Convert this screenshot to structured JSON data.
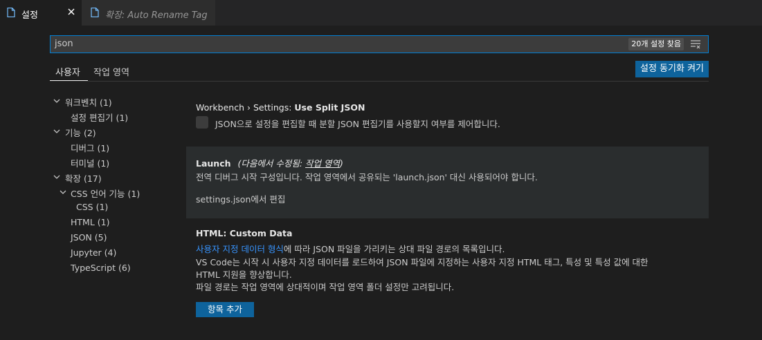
{
  "tabs": [
    {
      "label": "설정",
      "icon": "file-icon"
    },
    {
      "label": "확장: Auto Rename Tag",
      "icon": "file-icon"
    }
  ],
  "search": {
    "query": "json",
    "result_count": "20개 설정 찾음"
  },
  "scopes": {
    "user": "사용자",
    "workspace": "작업 영역"
  },
  "sync_button": "설정 동기화 켜기",
  "toc": [
    {
      "label": "워크벤치 (1)",
      "level": 0,
      "expanded": true
    },
    {
      "label": "설정 편집기 (1)",
      "level": 1
    },
    {
      "label": "기능 (2)",
      "level": 0,
      "expanded": true
    },
    {
      "label": "디버그 (1)",
      "level": 1
    },
    {
      "label": "터미널 (1)",
      "level": 1
    },
    {
      "label": "확장 (17)",
      "level": 0,
      "expanded": true
    },
    {
      "label": "CSS 언어 기능 (1)",
      "level": 1,
      "expanded": true
    },
    {
      "label": "CSS (1)",
      "level": 2
    },
    {
      "label": "HTML (1)",
      "level": 1
    },
    {
      "label": "JSON (5)",
      "level": 1
    },
    {
      "label": "Jupyter (4)",
      "level": 1
    },
    {
      "label": "TypeScript (6)",
      "level": 1
    }
  ],
  "settings": {
    "split_json": {
      "category": "Workbench › Settings: ",
      "name": "Use Split JSON",
      "description": "JSON으로 설정을 편집할 때 분할 JSON 편집기를 사용할지 여부를 제어합니다."
    },
    "launch": {
      "name": "Launch",
      "modified_prefix": "(다음에서 수정됨: ",
      "modified_scope": "작업 영역",
      "modified_suffix": ")",
      "description": "전역 디버그 시작 구성입니다. 작업 영역에서 공유되는 'launch.json' 대신 사용되어야 합니다.",
      "edit_link": "settings.json에서 편집"
    },
    "html_custom_data": {
      "category": "HTML: ",
      "name": "Custom Data",
      "link_text": "사용자 지정 데이터 형식",
      "desc_1": "에 따라 JSON 파일을 가리키는 상대 파일 경로의 목록입니다.",
      "desc_2": "VS Code는 시작 시 사용자 지정 데이터를 로드하여 JSON 파일에 지정하는 사용자 지정 HTML 태그, 특성 및 특성 값에 대한",
      "desc_3": "HTML 지원을 향상합니다.",
      "desc_4": "파일 경로는 작업 영역에 상대적이며 작업 영역 폴더 설정만 고려됩니다.",
      "add_button": "항목 추가"
    }
  }
}
